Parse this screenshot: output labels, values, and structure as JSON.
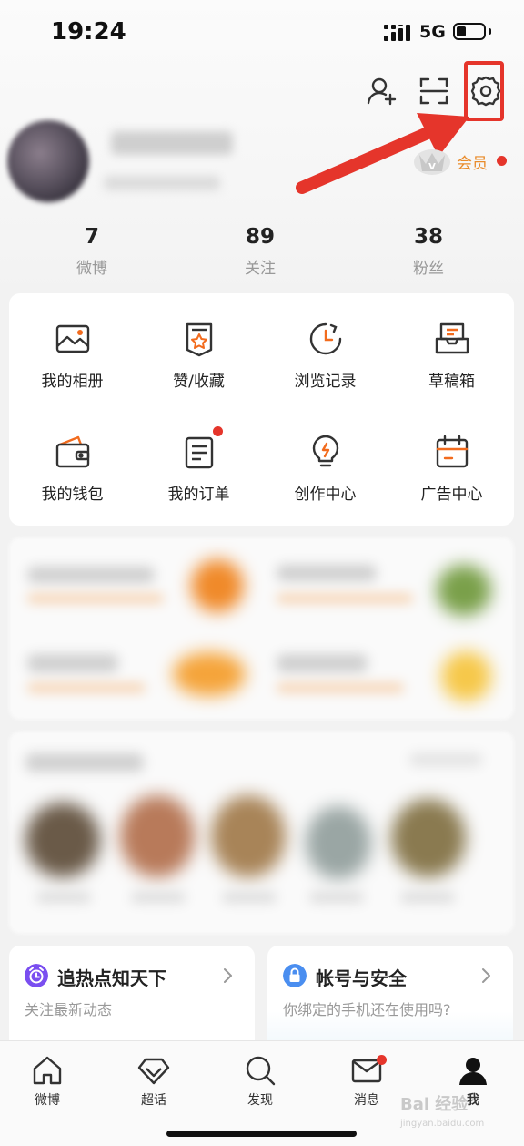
{
  "status_bar": {
    "time": "19:24",
    "network": "5G",
    "battery_level": 0.35
  },
  "header": {
    "add_friend_icon": "add-user-icon",
    "scan_icon": "scan-icon",
    "settings_icon": "gear-icon"
  },
  "annotation": {
    "highlight_color": "#e5352b"
  },
  "profile": {
    "vip_label": "会员"
  },
  "stats": [
    {
      "value": "7",
      "label": "微博"
    },
    {
      "value": "89",
      "label": "关注"
    },
    {
      "value": "38",
      "label": "粉丝"
    }
  ],
  "grid": [
    {
      "label": "我的相册",
      "icon": "photo-album-icon"
    },
    {
      "label": "赞/收藏",
      "icon": "favorites-icon"
    },
    {
      "label": "浏览记录",
      "icon": "history-icon"
    },
    {
      "label": "草稿箱",
      "icon": "drafts-icon"
    },
    {
      "label": "我的钱包",
      "icon": "wallet-icon"
    },
    {
      "label": "我的订单",
      "icon": "orders-icon"
    },
    {
      "label": "创作中心",
      "icon": "lightbulb-icon"
    },
    {
      "label": "广告中心",
      "icon": "calendar-icon"
    }
  ],
  "cards": [
    {
      "title": "追热点知天下",
      "subtitle": "关注最新动态",
      "icon": "alarm-clock-icon",
      "icon_color": "#7a4ef0"
    },
    {
      "title": "帐号与安全",
      "subtitle": "你绑定的手机还在使用吗?",
      "icon": "lock-icon",
      "icon_color": "#4a8ef0"
    }
  ],
  "tabbar": [
    {
      "label": "微博",
      "icon": "home-icon"
    },
    {
      "label": "超话",
      "icon": "diamond-icon"
    },
    {
      "label": "发现",
      "icon": "search-icon"
    },
    {
      "label": "消息",
      "icon": "mail-icon"
    },
    {
      "label": "我",
      "icon": "profile-icon",
      "active": true
    }
  ],
  "colors": {
    "accent_orange": "#f26b1d",
    "vip_orange": "#e98b2a",
    "badge_red": "#e5352b"
  },
  "watermark": {
    "line1": "Bai 经验",
    "line2": "jingyan.baidu.com"
  }
}
